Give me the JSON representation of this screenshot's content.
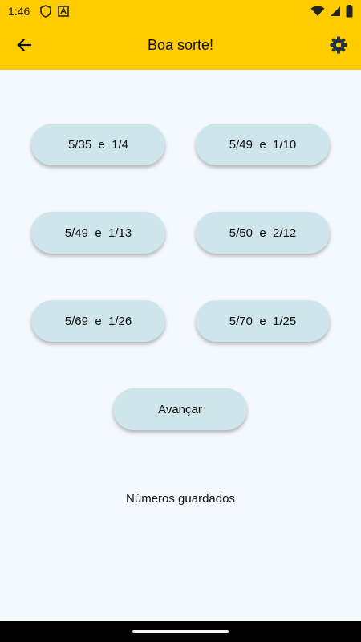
{
  "status_bar": {
    "time": "1:46",
    "icons_left": [
      "shield-icon",
      "font-icon"
    ],
    "icons_right": [
      "wifi-icon",
      "signal-icon",
      "battery-icon"
    ]
  },
  "app_bar": {
    "title": "Boa sorte!",
    "back_icon": "arrow-back-icon",
    "settings_icon": "gear-icon",
    "background": "#ffcc00"
  },
  "options": [
    {
      "label": "5/35  e  1/4"
    },
    {
      "label": "5/49  e  1/10"
    },
    {
      "label": "5/49  e  1/13"
    },
    {
      "label": "5/50  e  2/12"
    },
    {
      "label": "5/69  e  1/26"
    },
    {
      "label": "5/70  e  1/25"
    }
  ],
  "advance_button": {
    "label": "Avançar"
  },
  "saved_numbers_label": "Números guardados",
  "colors": {
    "pill_background": "#cfe5ec",
    "page_background": "#f4f9fd"
  }
}
